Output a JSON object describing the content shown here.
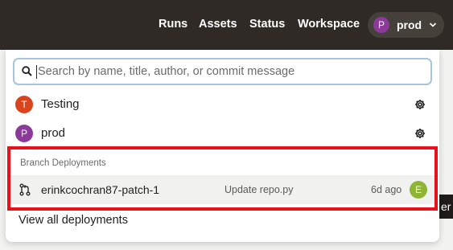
{
  "nav": {
    "items": [
      "Runs",
      "Assets",
      "Status",
      "Workspace"
    ],
    "workspace_pill": {
      "avatar_letter": "P",
      "label": "prod",
      "avatar_color": "#8b3a9a"
    }
  },
  "background_fragment": "er",
  "search": {
    "placeholder": "Search by name, title, author, or commit message",
    "value": ""
  },
  "workspaces": [
    {
      "letter": "T",
      "name": "Testing",
      "color": "#d9441c"
    },
    {
      "letter": "P",
      "name": "prod",
      "color": "#8b3a9a"
    }
  ],
  "branch_deployments": {
    "heading": "Branch Deployments",
    "items": [
      {
        "name": "erinkcochran87-patch-1",
        "message": "Update repo.py",
        "time": "6d ago",
        "author_letter": "E",
        "author_color": "#8fb536"
      }
    ]
  },
  "view_all_label": "View all deployments",
  "colors": {
    "topbar": "#2f2a26",
    "highlight": "#e8101a",
    "search_focus": "#a8c3dd"
  },
  "icons": [
    "search-icon",
    "chevron-down-icon",
    "gear-icon",
    "git-branch-icon"
  ]
}
